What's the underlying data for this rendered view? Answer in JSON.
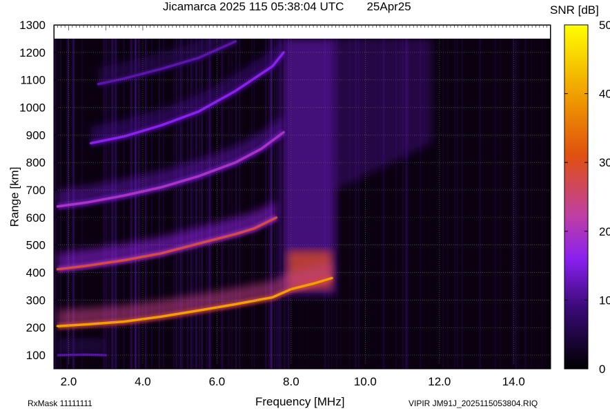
{
  "header": {
    "title": "Jicamarca 2025 115 05:38:04 UTC       25Apr25",
    "colorbar_title": "SNR [dB]"
  },
  "footer": {
    "left": "RxMask 11111111",
    "right": "VIPIR  JM91J_2025115053804.RIQ"
  },
  "chart_data": {
    "type": "heatmap",
    "title": "Jicamarca 2025 115 05:38:04 UTC       25Apr25",
    "xlabel": "Frequency [MHz]",
    "ylabel": "Range [km]",
    "xlim": [
      1.6,
      15.0
    ],
    "ylim": [
      50,
      1300
    ],
    "x_ticks": [
      "2.0",
      "4.0",
      "6.0",
      "8.0",
      "10.0",
      "12.0",
      "14.0"
    ],
    "x_tick_values": [
      2,
      4,
      6,
      8,
      10,
      12,
      14
    ],
    "y_ticks": [
      "100",
      "200",
      "300",
      "400",
      "500",
      "600",
      "700",
      "800",
      "900",
      "1000",
      "1100",
      "1200",
      "1300"
    ],
    "y_tick_values": [
      100,
      200,
      300,
      400,
      500,
      600,
      700,
      800,
      900,
      1000,
      1100,
      1200,
      1300
    ],
    "grid": true,
    "colorbar": {
      "label": "SNR [dB]",
      "range": [
        0,
        50
      ],
      "ticks": [
        "0",
        "10",
        "20",
        "30",
        "40",
        "50"
      ],
      "tick_values": [
        0,
        10,
        20,
        30,
        40,
        50
      ],
      "colors": [
        "#000000",
        "#3a0a78",
        "#8a20f0",
        "#c040a0",
        "#e05010",
        "#f0a000",
        "#ffff00"
      ]
    },
    "traces": [
      {
        "order": 1,
        "points": [
          [
            1.7,
            205
          ],
          [
            2.5,
            212
          ],
          [
            3.5,
            222
          ],
          [
            4.5,
            240
          ],
          [
            5.5,
            262
          ],
          [
            6.5,
            285
          ],
          [
            7.5,
            310
          ],
          [
            8.0,
            340
          ],
          [
            8.6,
            360
          ],
          [
            9.1,
            380
          ]
        ],
        "snr": 40
      },
      {
        "order": 2,
        "points": [
          [
            1.7,
            412
          ],
          [
            2.5,
            425
          ],
          [
            3.5,
            445
          ],
          [
            4.5,
            470
          ],
          [
            5.5,
            505
          ],
          [
            6.5,
            540
          ],
          [
            7.0,
            560
          ],
          [
            7.6,
            600
          ]
        ],
        "snr": 28
      },
      {
        "order": 3,
        "points": [
          [
            1.7,
            640
          ],
          [
            2.5,
            655
          ],
          [
            3.5,
            680
          ],
          [
            4.5,
            710
          ],
          [
            5.5,
            750
          ],
          [
            6.5,
            800
          ],
          [
            7.2,
            850
          ],
          [
            7.8,
            910
          ]
        ],
        "snr": 20
      },
      {
        "order": 4,
        "points": [
          [
            2.6,
            870
          ],
          [
            3.5,
            895
          ],
          [
            4.5,
            935
          ],
          [
            5.5,
            985
          ],
          [
            6.5,
            1060
          ],
          [
            7.5,
            1150
          ],
          [
            7.8,
            1200
          ]
        ],
        "snr": 16
      },
      {
        "order": 5,
        "points": [
          [
            2.8,
            1085
          ],
          [
            3.5,
            1105
          ],
          [
            4.5,
            1140
          ],
          [
            5.5,
            1180
          ],
          [
            6.5,
            1240
          ]
        ],
        "snr": 12
      },
      {
        "order": 6,
        "points": [
          [
            1.7,
            100
          ],
          [
            2.5,
            102
          ],
          [
            3.0,
            100
          ]
        ],
        "snr": 11
      }
    ],
    "spread_region": {
      "x": [
        7.8,
        9.2
      ],
      "range": [
        320,
        1250
      ],
      "snr": 30
    },
    "diffuse_region": {
      "x": [
        9.2,
        11.8
      ],
      "range": [
        650,
        1250
      ],
      "snr": 12
    }
  }
}
